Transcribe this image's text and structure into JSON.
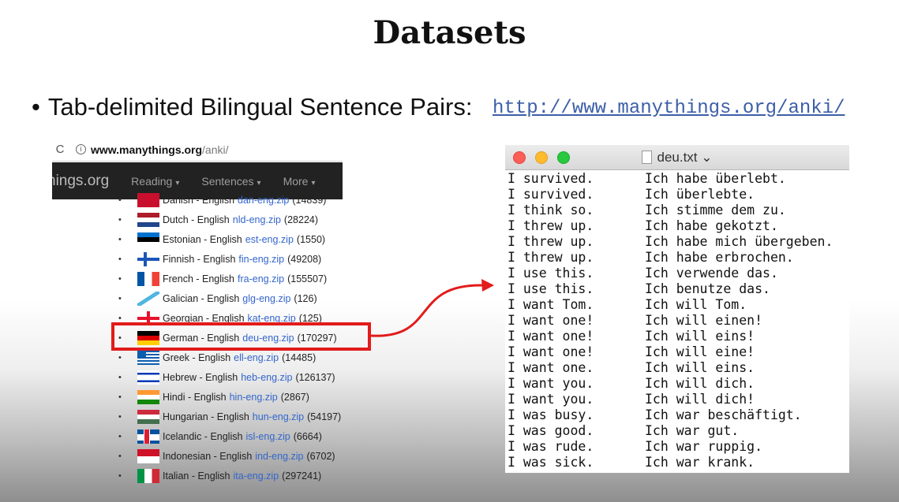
{
  "slide": {
    "title": "Datasets",
    "bullet_text": "Tab-delimited Bilingual Sentence Pairs:",
    "bullet_url": "http://www.manythings.org/anki/"
  },
  "browser": {
    "address_host": "www.manythings.org",
    "address_path": "/anki/",
    "nav_brand": "hings.org",
    "nav_items": [
      "Reading",
      "Sentences",
      "More"
    ]
  },
  "languages": [
    {
      "flag": "dk",
      "text": "Danish - English",
      "zip": "dan-eng.zip",
      "count": "(14839)"
    },
    {
      "flag": "nl",
      "text": "Dutch - English",
      "zip": "nld-eng.zip",
      "count": "(28224)"
    },
    {
      "flag": "ee",
      "text": "Estonian - English",
      "zip": "est-eng.zip",
      "count": "(1550)"
    },
    {
      "flag": "fi",
      "text": "Finnish - English",
      "zip": "fin-eng.zip",
      "count": "(49208)"
    },
    {
      "flag": "fr",
      "text": "French - English",
      "zip": "fra-eng.zip",
      "count": "(155507)"
    },
    {
      "flag": "gl",
      "text": "Galician - English",
      "zip": "glg-eng.zip",
      "count": "(126)"
    },
    {
      "flag": "ge",
      "text": "Georgian - English",
      "zip": "kat-eng.zip",
      "count": "(125)"
    },
    {
      "flag": "de",
      "text": "German - English",
      "zip": "deu-eng.zip",
      "count": "(170297)"
    },
    {
      "flag": "gr",
      "text": "Greek - English",
      "zip": "ell-eng.zip",
      "count": "(14485)"
    },
    {
      "flag": "il",
      "text": "Hebrew - English",
      "zip": "heb-eng.zip",
      "count": "(126137)"
    },
    {
      "flag": "in",
      "text": "Hindi - English",
      "zip": "hin-eng.zip",
      "count": "(2867)"
    },
    {
      "flag": "hu",
      "text": "Hungarian - English",
      "zip": "hun-eng.zip",
      "count": "(54197)"
    },
    {
      "flag": "is",
      "text": "Icelandic - English",
      "zip": "isl-eng.zip",
      "count": "(6664)"
    },
    {
      "flag": "id",
      "text": "Indonesian - English",
      "zip": "ind-eng.zip",
      "count": "(6702)"
    },
    {
      "flag": "it",
      "text": "Italian - English",
      "zip": "ita-eng.zip",
      "count": "(297241)"
    }
  ],
  "terminal": {
    "filename": "deu.txt",
    "rows": [
      [
        "I survived.",
        "Ich habe überlebt."
      ],
      [
        "I survived.",
        "Ich überlebte."
      ],
      [
        "I think so.",
        "Ich stimme dem zu."
      ],
      [
        "I threw up.",
        "Ich habe gekotzt."
      ],
      [
        "I threw up.",
        "Ich habe mich übergeben."
      ],
      [
        "I threw up.",
        "Ich habe erbrochen."
      ],
      [
        "I use this.",
        "Ich verwende das."
      ],
      [
        "I use this.",
        "Ich benutze das."
      ],
      [
        "I want Tom.",
        "Ich will Tom."
      ],
      [
        "I want one!",
        "Ich will einen!"
      ],
      [
        "I want one!",
        "Ich will eins!"
      ],
      [
        "I want one!",
        "Ich will eine!"
      ],
      [
        "I want one.",
        "Ich will eins."
      ],
      [
        "I want you.",
        "Ich will dich."
      ],
      [
        "I want you.",
        "Ich will dich!"
      ],
      [
        "I was busy.",
        "Ich war beschäftigt."
      ],
      [
        "I was good.",
        "Ich war gut."
      ],
      [
        "I was rude.",
        "Ich war ruppig."
      ],
      [
        "I was sick.",
        "Ich war krank."
      ]
    ]
  },
  "colors": {
    "highlight": "#e21b1b",
    "link": "#3366cc",
    "navbar": "#222222"
  }
}
